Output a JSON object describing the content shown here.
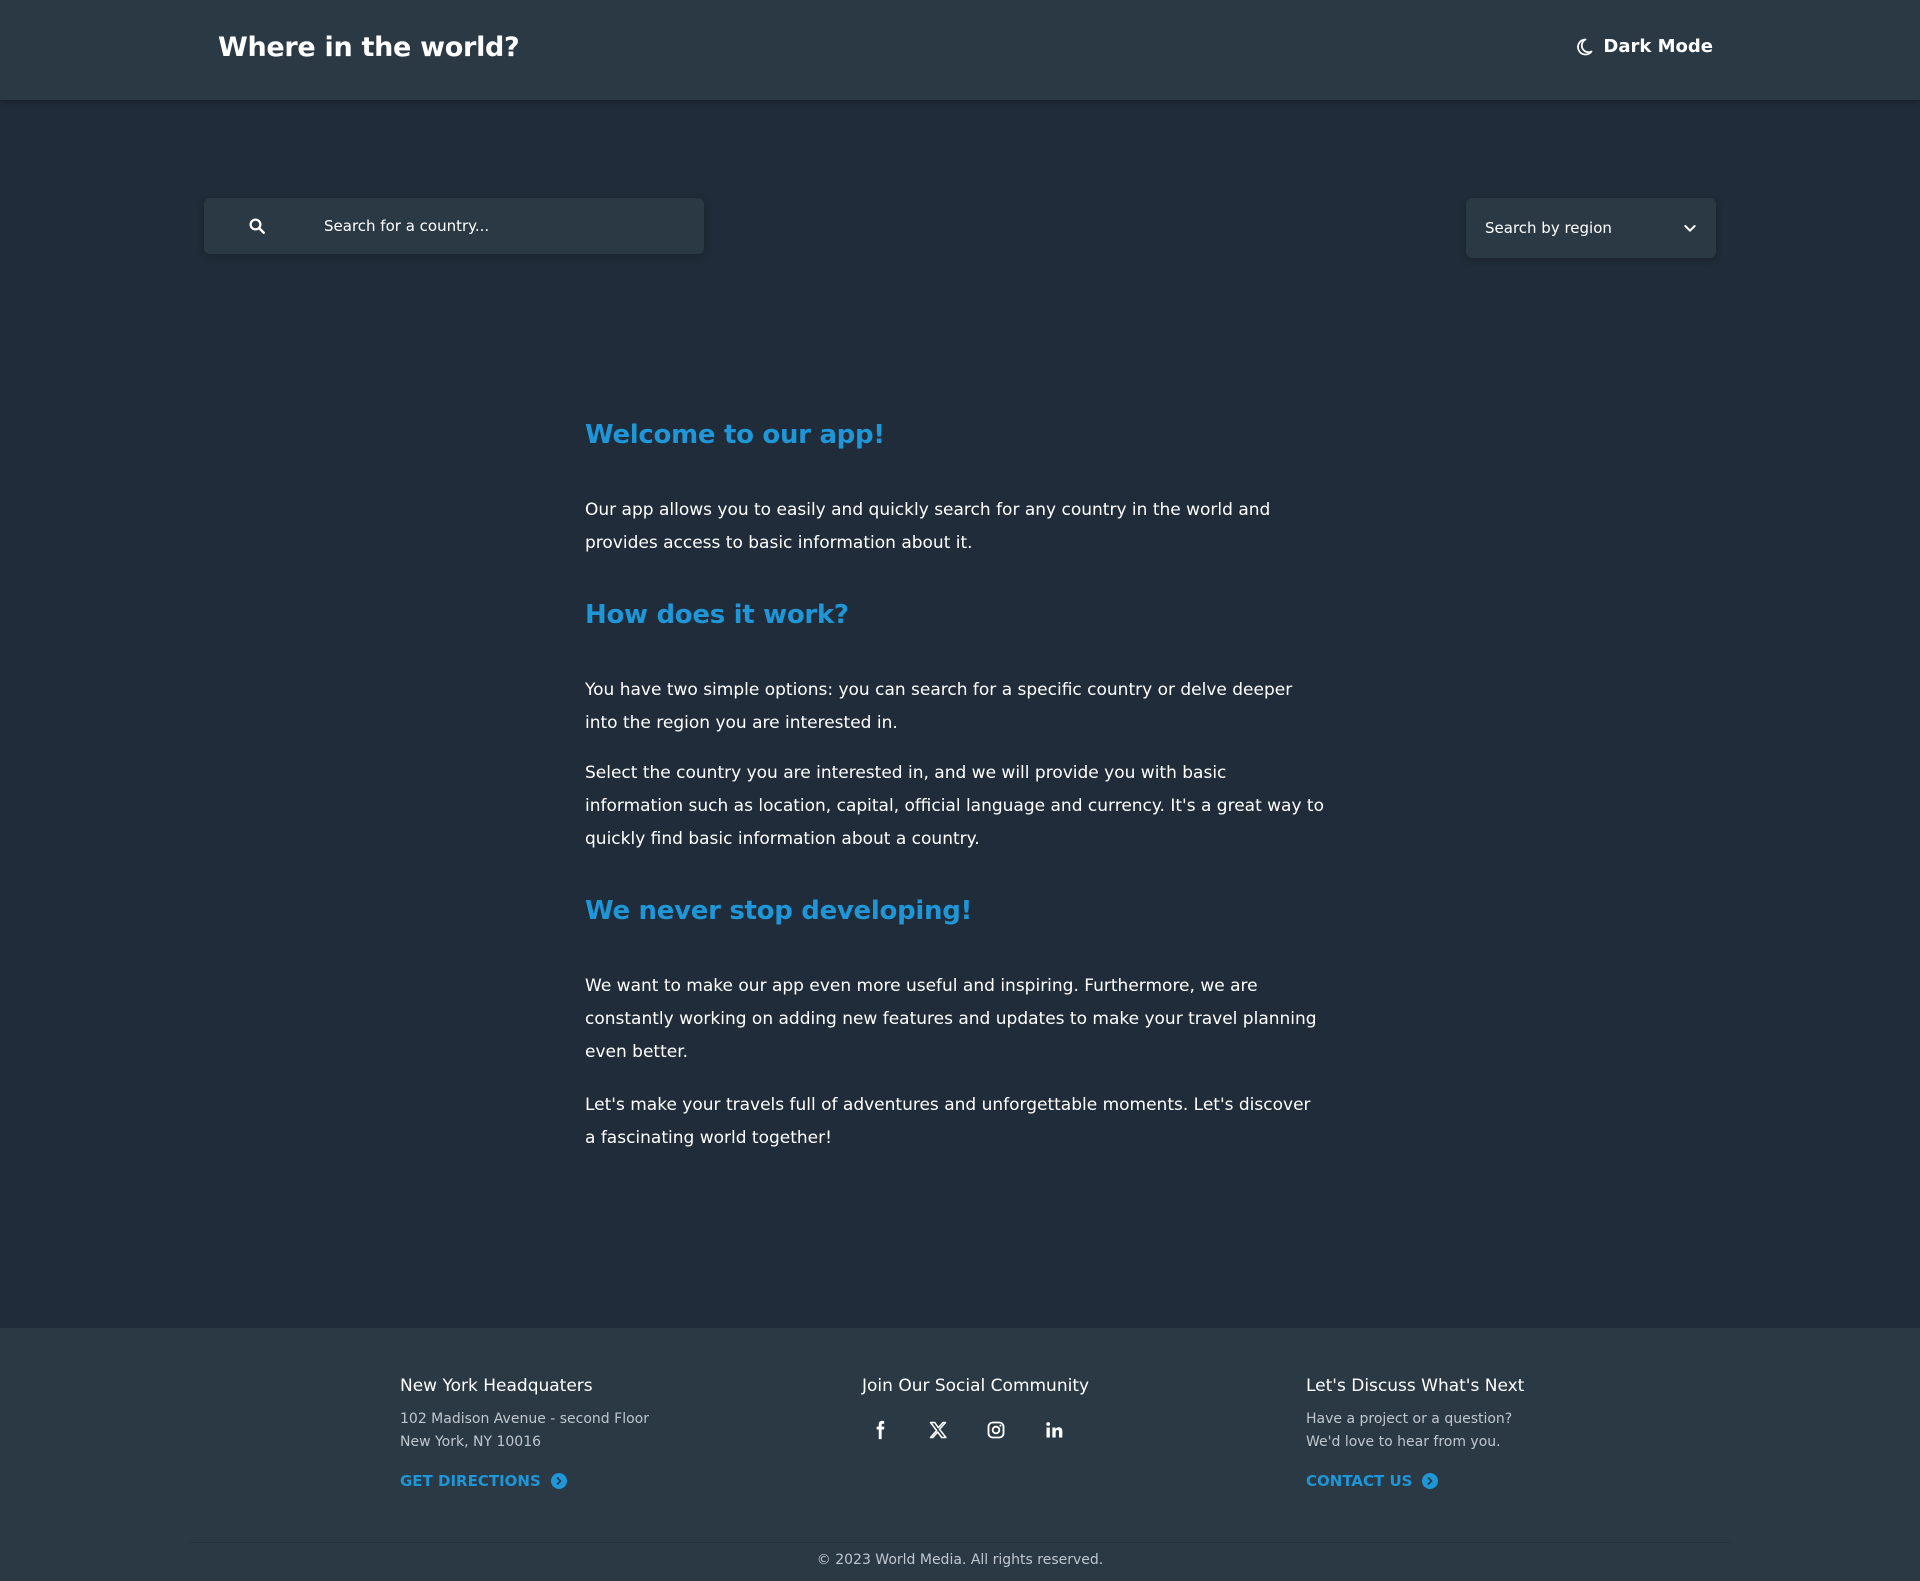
{
  "header": {
    "title": "Where in the world?",
    "dark_mode_label": "Dark Mode",
    "dark_mode_icon": "moon-icon"
  },
  "search": {
    "placeholder": "Search for a country...",
    "value": ""
  },
  "region_filter": {
    "label": "Search by region"
  },
  "content": {
    "heading_1": "Welcome to our app!",
    "para_1": "Our app allows you to easily and quickly search for any country in the world and provides access to basic information about it.",
    "heading_2": "How does it work?",
    "para_2": "You have two simple options: you can search for a specific country or delve deeper into the region you are interested in.",
    "para_3": "Select the country you are interested in, and we will provide you with basic information such as location, capital, official language and currency. It's a great way to quickly find basic information about a country.",
    "heading_3": "We never stop developing!",
    "para_4": "We want to make our app even more useful and inspiring. Furthermore, we are constantly working on adding new features and updates to make your travel planning even better.",
    "para_5": "Let's make your travels full of adventures and unforgettable moments. Let's discover a fascinating world together!"
  },
  "footer": {
    "hq": {
      "title": "New York Headquaters",
      "address_line_1": "102 Madison Avenue - second Floor",
      "address_line_2": "New York, NY 10016",
      "link": "GET DIRECTIONS"
    },
    "social": {
      "title": "Join Our Social Community",
      "icons": [
        "facebook-icon",
        "x-icon",
        "instagram-icon",
        "linkedin-icon"
      ]
    },
    "contact": {
      "title": "Let's Discuss What's Next",
      "line_1": "Have a project or a question?",
      "line_2": "We'd love to hear from you.",
      "link": "CONTACT US"
    },
    "copyright": "© 2023 World Media. All rights reserved."
  },
  "colors": {
    "background": "#202c39",
    "surface": "#2b3945",
    "accent": "#1e96d7",
    "text": "#ffffff"
  }
}
